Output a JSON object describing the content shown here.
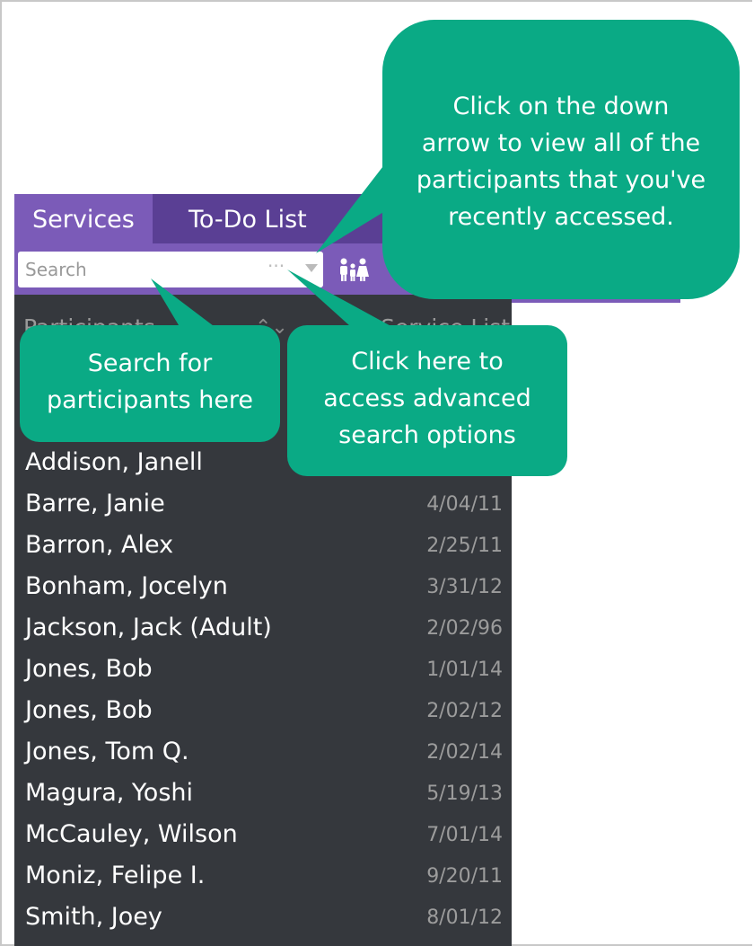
{
  "tabs": [
    {
      "label": "Services",
      "active": true
    },
    {
      "label": "To-Do List",
      "active": false
    }
  ],
  "search": {
    "placeholder": "Search",
    "more_label": "···"
  },
  "list_header": {
    "left": "Participants",
    "right": "Service List"
  },
  "participants": [
    {
      "name": "Addison, Janell",
      "date": ""
    },
    {
      "name": "Barre, Janie",
      "date": "4/04/11"
    },
    {
      "name": "Barron, Alex",
      "date": "2/25/11"
    },
    {
      "name": "Bonham, Jocelyn",
      "date": "3/31/12"
    },
    {
      "name": "Jackson, Jack (Adult)",
      "date": "2/02/96"
    },
    {
      "name": "Jones, Bob",
      "date": "1/01/14"
    },
    {
      "name": "Jones, Bob",
      "date": "2/02/12"
    },
    {
      "name": "Jones, Tom Q.",
      "date": "2/02/14"
    },
    {
      "name": "Magura, Yoshi",
      "date": "5/19/13"
    },
    {
      "name": "McCauley, Wilson",
      "date": "7/01/14"
    },
    {
      "name": "Moniz, Felipe I.",
      "date": "9/20/11"
    },
    {
      "name": "Smith, Joey",
      "date": "8/01/12"
    }
  ],
  "callouts": {
    "down_arrow": [
      "Click on the down",
      "arrow to view all of the",
      "participants that you've",
      "recently accessed."
    ],
    "search": [
      "Search for",
      "participants here"
    ],
    "advanced": [
      "Click here to",
      "access advanced",
      "search options"
    ]
  },
  "colors": {
    "tab_bar": "#5a3f94",
    "accent": "#7b5bb8",
    "list_bg": "#35383d",
    "callout": "#0aaa85"
  }
}
